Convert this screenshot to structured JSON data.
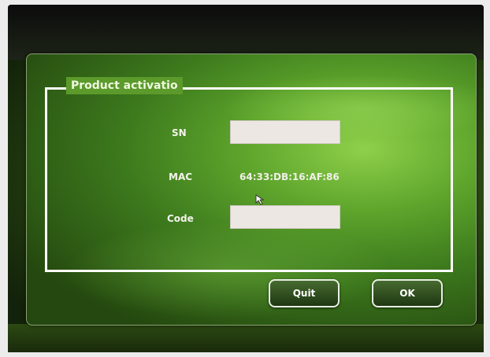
{
  "dialog": {
    "title": "Product activatio",
    "fields": {
      "sn_label": "SN",
      "sn_value": "",
      "mac_label": "MAC",
      "mac_value": "64:33:DB:16:AF:86",
      "code_label": "Code",
      "code_value": ""
    },
    "buttons": {
      "quit": "Quit",
      "ok": "OK"
    }
  },
  "colors": {
    "accent_green": "#5ea52c",
    "field_bg": "#ede7e4",
    "border_white": "#ffffff"
  },
  "icons": {
    "cursor": "arrow-cursor-icon"
  }
}
